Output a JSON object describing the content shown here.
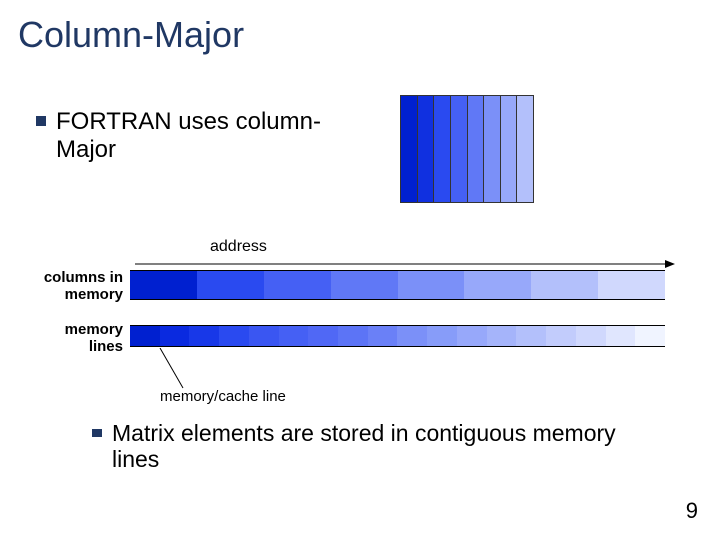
{
  "title": "Column-Major",
  "bullet1": "FORTRAN uses column-Major",
  "labels": {
    "address": "address",
    "columns_in_memory": "columns in memory",
    "memory_lines": "memory lines",
    "cache_line": "memory/cache line"
  },
  "bullet2": "Matrix elements are stored in contiguous memory lines",
  "page_number": "9",
  "colors": {
    "matrix_cols": [
      "#0020d0",
      "#1030e0",
      "#2a4af0",
      "#4560f4",
      "#6078f6",
      "#7b90f8",
      "#97a8fa",
      "#b3c0fb"
    ],
    "memory_cols": [
      "#0020d0",
      "#2a4af0",
      "#4560f4",
      "#6078f6",
      "#7b90f8",
      "#97a8fa",
      "#b3c0fb",
      "#d0d8fd"
    ],
    "memory_lines": [
      "#0020d0",
      "#0a2ae0",
      "#1838e8",
      "#2a4af0",
      "#3a56f2",
      "#4560f4",
      "#5068f5",
      "#5c74f6",
      "#6a80f7",
      "#7b90f8",
      "#879cf9",
      "#97a8fa",
      "#a5b4fa",
      "#b3c0fb",
      "#c2ccfc",
      "#d0d8fd",
      "#e0e6fe",
      "#f0f4ff"
    ]
  }
}
